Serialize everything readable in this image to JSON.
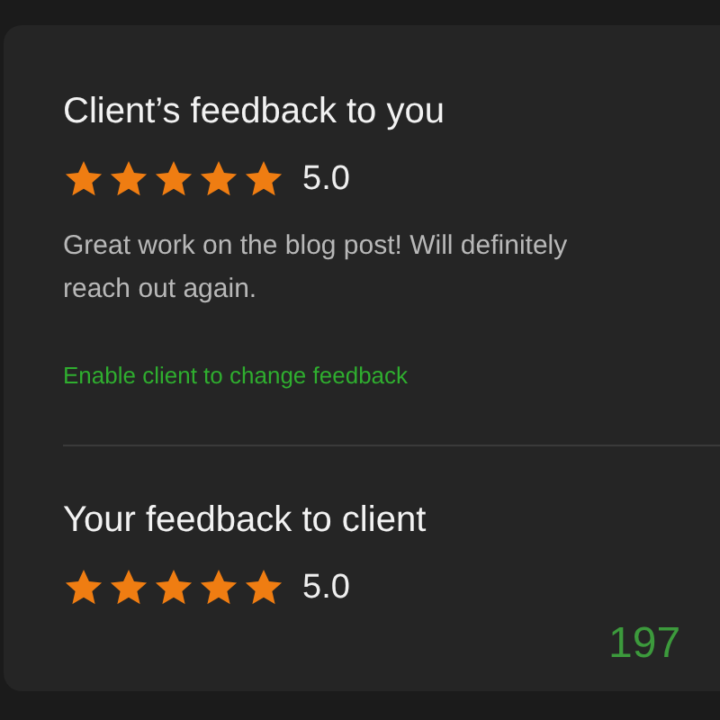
{
  "client_feedback": {
    "title": "Client’s feedback to you",
    "stars": 5,
    "rating": "5.0",
    "comment": "Great work on the blog post! Will definitely reach out again.",
    "link": "Enable client to change feedback"
  },
  "your_feedback": {
    "title": "Your feedback to client",
    "stars": 5,
    "rating": "5.0"
  },
  "counter": "197"
}
